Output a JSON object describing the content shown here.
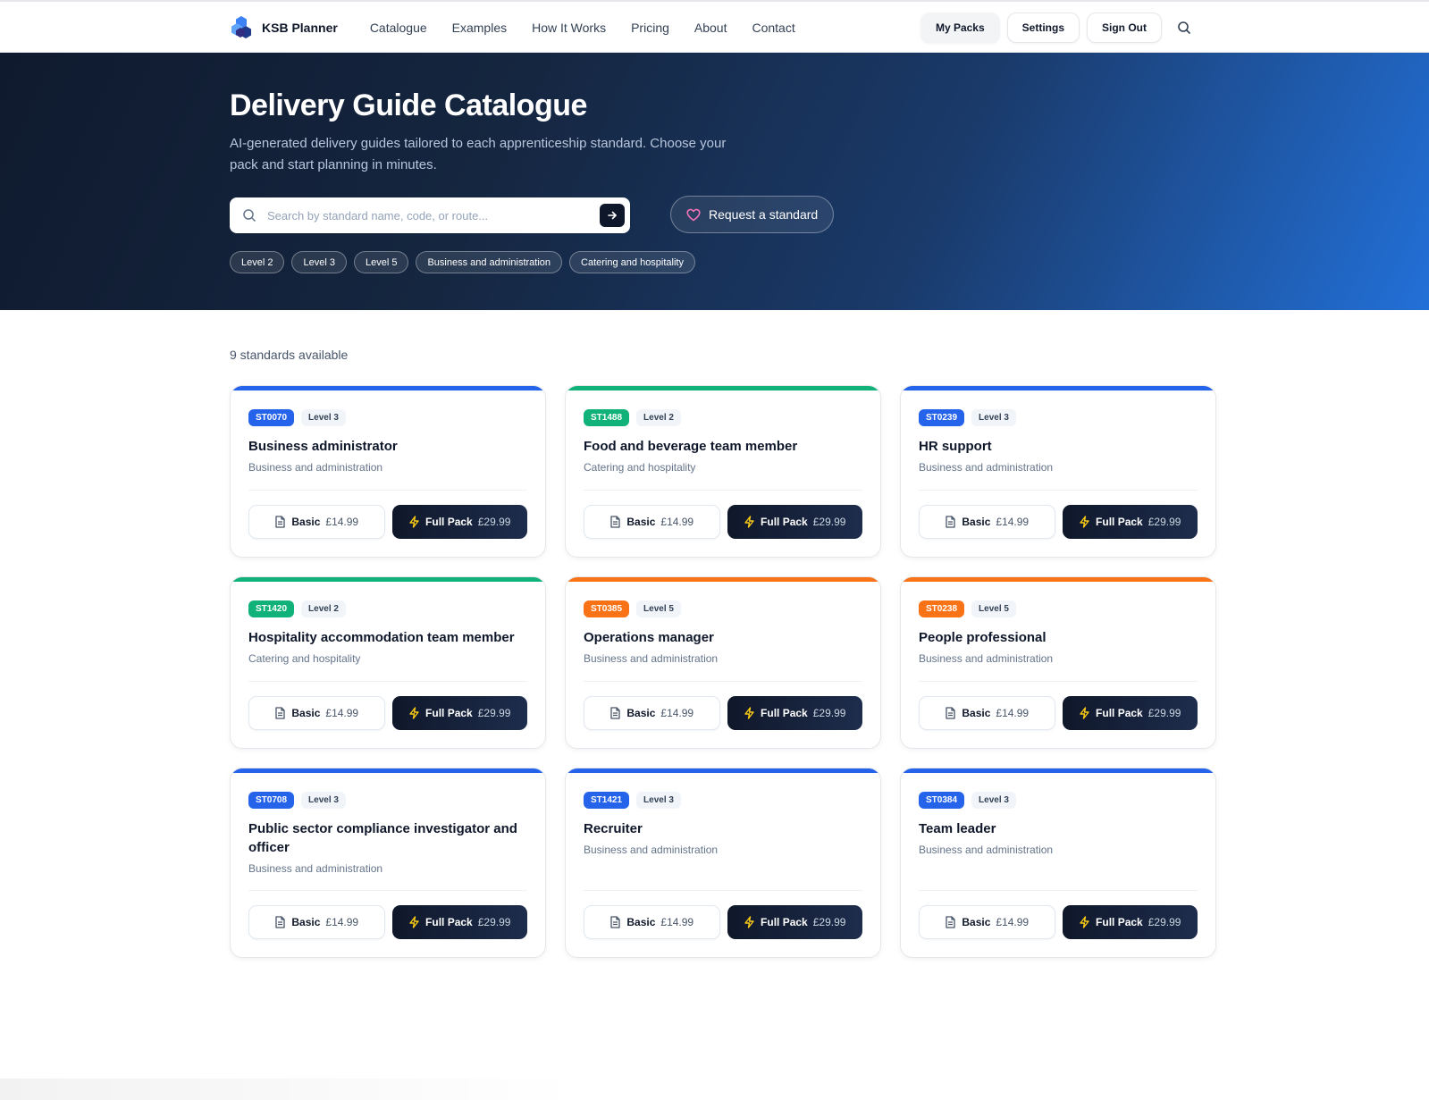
{
  "nav": {
    "brand": "KSB Planner",
    "links": [
      "Catalogue",
      "Examples",
      "How It Works",
      "Pricing",
      "About",
      "Contact"
    ],
    "my_packs": "My Packs",
    "settings": "Settings",
    "sign_out": "Sign Out",
    "search_icon": "search-icon"
  },
  "hero": {
    "title": "Delivery Guide Catalogue",
    "subtitle": "AI-generated delivery guides tailored to each apprenticeship standard. Choose your pack and start planning in minutes.",
    "search_placeholder": "Search by standard name, code, or route...",
    "request_label": "Request a standard",
    "chips": [
      "Level 2",
      "Level 3",
      "Level 5",
      "Business and administration",
      "Catering and hospitality"
    ]
  },
  "catalogue": {
    "count_text": "9 standards available",
    "basic_label": "Basic",
    "basic_price": "£14.99",
    "full_label": "Full Pack",
    "full_price": "£29.99",
    "colors": {
      "blue": "#2563eb",
      "green": "#10b27a",
      "orange": "#f97316",
      "bolt": "#facc15"
    },
    "standards": [
      {
        "code": "ST0070",
        "level": "Level 3",
        "title": "Business administrator",
        "route": "Business and administration",
        "color": "blue"
      },
      {
        "code": "ST1488",
        "level": "Level 2",
        "title": "Food and beverage team member",
        "route": "Catering and hospitality",
        "color": "green"
      },
      {
        "code": "ST0239",
        "level": "Level 3",
        "title": "HR support",
        "route": "Business and administration",
        "color": "blue"
      },
      {
        "code": "ST1420",
        "level": "Level 2",
        "title": "Hospitality accommodation team member",
        "route": "Catering and hospitality",
        "color": "green"
      },
      {
        "code": "ST0385",
        "level": "Level 5",
        "title": "Operations manager",
        "route": "Business and administration",
        "color": "orange"
      },
      {
        "code": "ST0238",
        "level": "Level 5",
        "title": "People professional",
        "route": "Business and administration",
        "color": "orange"
      },
      {
        "code": "ST0708",
        "level": "Level 3",
        "title": "Public sector compliance investigator and officer",
        "route": "Business and administration",
        "color": "blue"
      },
      {
        "code": "ST1421",
        "level": "Level 3",
        "title": "Recruiter",
        "route": "Business and administration",
        "color": "blue"
      },
      {
        "code": "ST0384",
        "level": "Level 3",
        "title": "Team leader",
        "route": "Business and administration",
        "color": "blue"
      }
    ]
  }
}
